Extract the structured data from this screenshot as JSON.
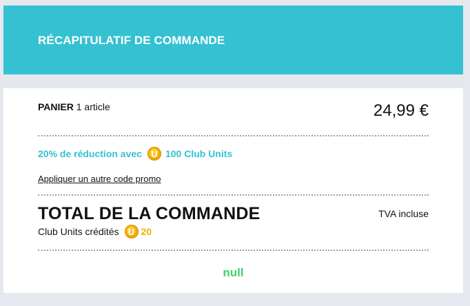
{
  "header": {
    "title": "RÉCAPITULATIF DE COMMANDE"
  },
  "cart": {
    "label": "PANIER",
    "count_text": "1 article",
    "price": "24,99 €"
  },
  "discount": {
    "text": "20% de réduction avec",
    "coin_letter": "U",
    "units": "100 Club Units"
  },
  "promo": {
    "link_text": "Appliquer un autre code promo"
  },
  "total": {
    "title": "TOTAL DE LA COMMANDE",
    "tax_note": "TVA incluse",
    "credited_label": "Club Units crédités",
    "coin_letter": "U",
    "credited_units": "20"
  },
  "footer": {
    "value": "null"
  },
  "colors": {
    "accent": "#35c1d1",
    "coin": "#f0a500",
    "credit": "#e8b200",
    "footer": "#3ed36b"
  }
}
